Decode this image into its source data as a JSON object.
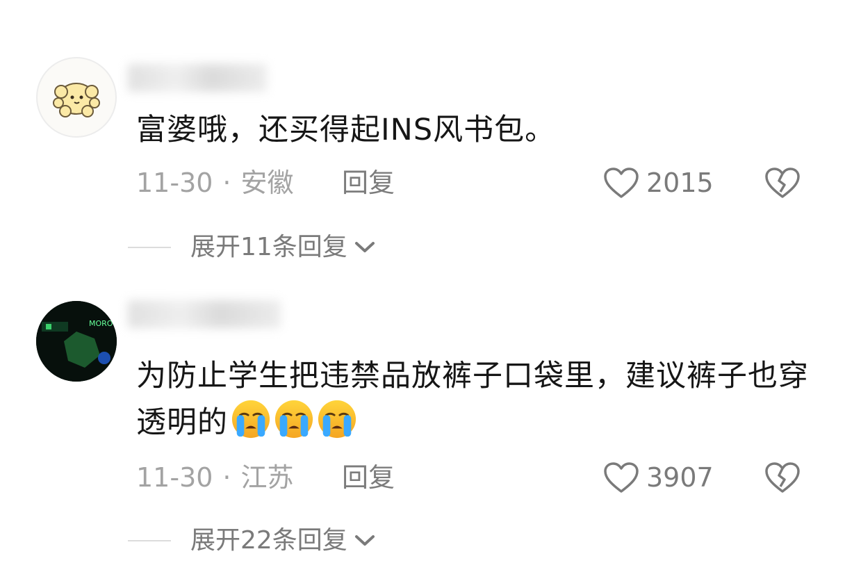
{
  "comments": [
    {
      "text": "富婆哦，还买得起INS风书包。",
      "date": "11-30",
      "location": "安徽",
      "reply_label": "回复",
      "likes": "2015",
      "expand_label": "展开11条回复"
    },
    {
      "text": "为防止学生把违禁品放裤子口袋里，建议裤子也穿透明的",
      "emoji_count": 3,
      "emoji_name": "crying-face-emoji",
      "date": "11-30",
      "location": "江苏",
      "reply_label": "回复",
      "likes": "3907",
      "expand_label": "展开22条回复"
    }
  ],
  "icons": {
    "like": "heart-icon",
    "dislike": "broken-heart-icon",
    "expand": "chevron-down-icon"
  },
  "colors": {
    "text": "#161616",
    "meta": "#a3a3a3",
    "secondary": "#7a7a7a"
  }
}
